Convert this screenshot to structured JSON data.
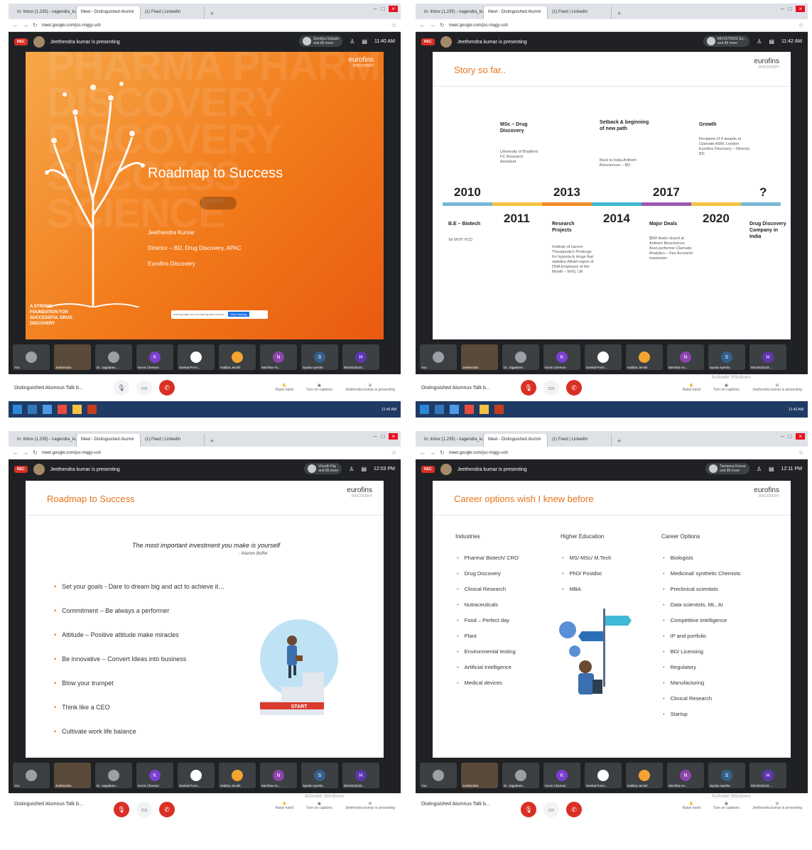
{
  "browser": {
    "tabs": [
      "In: Inbox (1,235) - nagendra_kumar",
      "Meet - Distinguished Alumni",
      "(1) Feed | LinkedIn"
    ],
    "url": "meet.google.com/jsc-mqgy-ush"
  },
  "meet": {
    "rec": "REC",
    "presenting": "Jeethendra kumar is presenting",
    "meeting_name": "Distinguished Alumnus Talk b...",
    "activate_windows": "Activate Windows",
    "raise_hand": "Raise hand",
    "captions": "Turn on captions",
    "presenter_label": "Jeethendra kumar is presenting",
    "participants": [
      "You",
      "Jeethendra",
      "Dr. Jagadees...",
      "Kevin Cheeran",
      "Snehal Prem...",
      "Habiba Jenish",
      "Merritha An...",
      "Syeda Ayesha",
      "IMV3018133..."
    ],
    "quads": [
      {
        "time": "11:40 AM",
        "chip_top": "Srividya Subash",
        "chip_bottom": "and 86 more"
      },
      {
        "time": "11:42 AM",
        "chip_top": "IMV15T0033 Sa...",
        "chip_bottom": "and 89 more"
      },
      {
        "time": "12:03 PM",
        "chip_top": "Vinodh Raj",
        "chip_bottom": "and 86 more"
      },
      {
        "time": "12:11 PM",
        "chip_top": "Tamanna Kumar",
        "chip_bottom": "and 86 more"
      }
    ]
  },
  "slide1": {
    "bg_text": "PHARMA PHARMA DISCOVERY DISCOVERY SUCCESS SCIENCE",
    "logo": "eurofins",
    "logo_sub": "DISCOVERY",
    "title": "Roadmap to Success",
    "name": "Jeethendra Kumar",
    "role": "Director – BD, Drug Discovery, APAC",
    "company": "Eurofins Discovery",
    "foundation": "A STRONG FOUNDATION FOR SUCCESSFUL DRUG DISCOVERY",
    "notif": "meet.google.com is sharing your screen.",
    "notif_btn": "Stop sharing",
    "notif_hide": "Hide"
  },
  "slide2": {
    "title": "Story so far..",
    "logo": "eurofins",
    "logo_sub": "DISCOVERY",
    "years_top": [
      "2010",
      "2013",
      "2017",
      "?"
    ],
    "years_bottom": [
      "2011",
      "2014",
      "2020"
    ],
    "top_captions": [
      {
        "head": "MSc – Drug Discovery",
        "sub": "University of Bradford FC Research Assistant"
      },
      {
        "head": "Setback & beginning of new path",
        "sub": "Back to India Anthem Biosciences – BD"
      },
      {
        "head": "Growth",
        "sub": "Recipient of 4 awards at Clarivate ASM, London Eurofins Discovery – Director, BD"
      }
    ],
    "bottom_captions": [
      {
        "head": "B.E – Biotech",
        "sub": "Sir MVIT FCD"
      },
      {
        "head": "Research Projects",
        "sub": "Institute of cancer Therapeutics Prodrugs for hypoxia & drugs that stabilize AAsbf region of DNA Employee of the Month – NHS, UK"
      },
      {
        "head": "Major Deals",
        "sub": "$5M deals closed at Anthem Biosciences Best performer Clarivate Analytics – Key Accounts expansion"
      },
      {
        "head": "Drug Discovery Company in India",
        "sub": ""
      }
    ]
  },
  "slide3": {
    "title": "Roadmap to Success",
    "logo": "eurofins",
    "logo_sub": "DISCOVERY",
    "quote": "The most important investment you make is yourself",
    "quote_by": "- Warren Buffet",
    "bullets": [
      "Set your goals - Dare to dream big and act to achieve it…",
      "Commitment – Be always a performer",
      "Attitude – Positive attitude make miracles",
      "Be innovative – Convert Ideas into business",
      "Blow your trumpet",
      "Think like a CEO",
      "Cultivate work life balance"
    ],
    "start": "START"
  },
  "slide4": {
    "title": "Career options wish I knew before",
    "logo": "eurofins",
    "logo_sub": "DISCOVERY",
    "col1_head": "Industries",
    "col1": [
      "Pharma/ Biotech/ CRO",
      "Drug Discovery",
      "Clinical Research",
      "Nutraceuticals",
      "Food – Perfect day",
      "Plant",
      "Environmental testing",
      "Artificial Intelligence",
      "Medical devices"
    ],
    "col2_head": "Higher Education",
    "col2": [
      "MS/ MSc/ M.Tech",
      "PhD/ Postdoc",
      "MBA"
    ],
    "col3_head": "Career Options",
    "col3": [
      "Biologists",
      "Medicinal/ synthetic Chemists",
      "Preclinical scientists",
      "Data scientists, ML, AI",
      "Competitive Intelligence",
      "IP and portfolio",
      "BD/ Licensing",
      "Regulatory",
      "Manufacturing",
      "Clinical Research",
      "Startup"
    ]
  },
  "colors": {
    "accent": "#e8731a",
    "meet_bg": "#202124",
    "rec": "#d93025"
  }
}
